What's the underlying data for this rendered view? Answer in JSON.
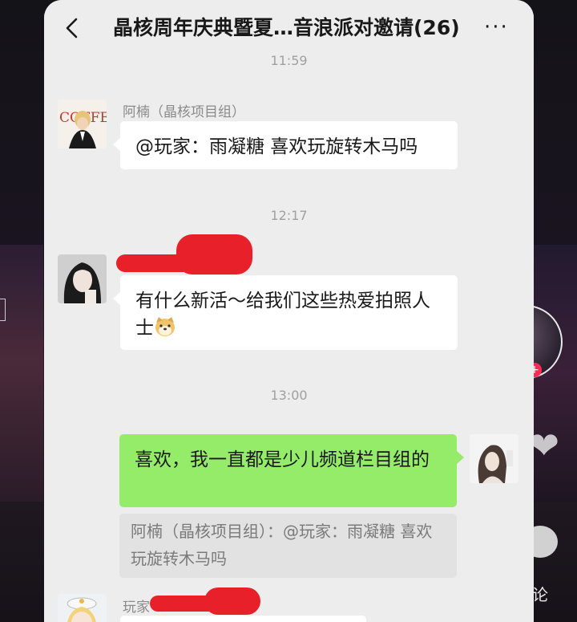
{
  "header": {
    "title": "晶核周年庆典暨夏…音浪派对邀请(26)",
    "back_icon": "chevron-left-icon",
    "more_icon": "more-dots-icon",
    "more_glyph": "···"
  },
  "messages": [
    {
      "time": "11:59"
    },
    {
      "sender": "阿楠（晶核项目组）",
      "text": "@玩家：雨凝糖 喜欢玩旋转木马吗",
      "side": "left",
      "avatar_label": "COFFEE"
    },
    {
      "time": "12:17"
    },
    {
      "sender": "",
      "text": "有什么新活～给我们这些热爱拍照人士",
      "emoji": "dog-face-emoji",
      "side": "left"
    },
    {
      "time": "13:00"
    },
    {
      "text": "喜欢，我一直都是少儿频道栏目组的",
      "side": "right",
      "quote": "阿楠（晶核项目组）：@玩家：雨凝糖 喜欢玩旋转木马吗"
    },
    {
      "sender": "玩家",
      "side": "left"
    }
  ],
  "background": {
    "comment_label": "论",
    "follow_plus": "+",
    "accent_red": "#fe2c55"
  },
  "colors": {
    "chat_bg": "#ededed",
    "bubble_self": "#95ec69",
    "bubble_other": "#ffffff",
    "redaction": "#e8202a"
  }
}
